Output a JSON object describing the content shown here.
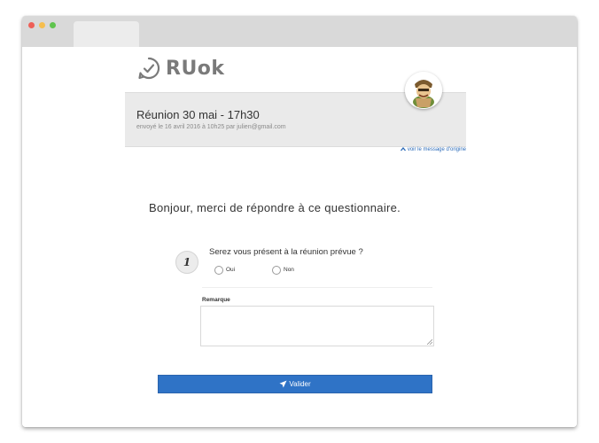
{
  "browser": {
    "traffic_lights": [
      "#ee5f57",
      "#f6be4f",
      "#5fc44e"
    ]
  },
  "app": {
    "logo_text": "RUok",
    "avatar_icon": "character-avatar"
  },
  "meeting": {
    "title": "Réunion 30 mai - 17h30",
    "subtitle": "envoyé le 16 avril 2016 à 10h25 par julien@gmail.com",
    "origin_link": "voir le message d'origine"
  },
  "greeting": "Bonjour, merci de répondre à ce questionnaire.",
  "question": {
    "number": "1",
    "text": "Serez vous présent à la réunion prévue ?",
    "options": [
      "Oui",
      "Non"
    ]
  },
  "remark": {
    "label": "Remarque",
    "value": ""
  },
  "submit": {
    "label": "Valider",
    "color": "#2f73c6"
  }
}
